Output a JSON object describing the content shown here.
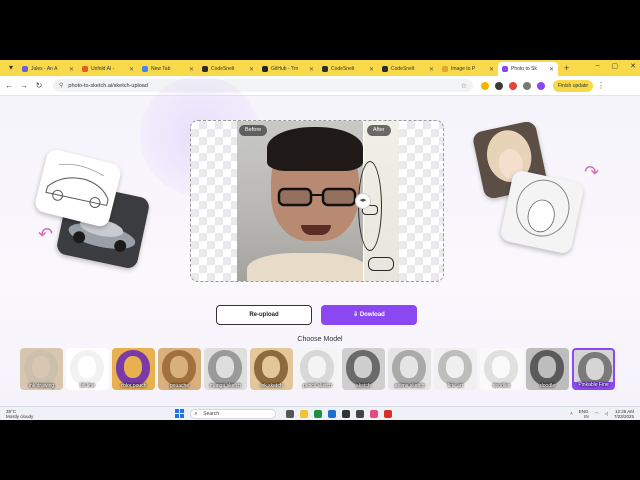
{
  "browser": {
    "tabs": [
      {
        "title": "Jules - An A",
        "color": "#6b5fd6"
      },
      {
        "title": "Unfold AI - ",
        "color": "#e25b2b"
      },
      {
        "title": "New Tab",
        "color": "#4285f4"
      },
      {
        "title": "CodeSnelt",
        "color": "#2b2b2b"
      },
      {
        "title": "GitHub - Trn",
        "color": "#222222"
      },
      {
        "title": "CodeSnelt",
        "color": "#2b2b2b"
      },
      {
        "title": "CodeSnelt",
        "color": "#2b2b2b"
      },
      {
        "title": "Image to P",
        "color": "#e2a52b"
      },
      {
        "title": "Photo to Sk",
        "color": "#8a47f2"
      }
    ],
    "active_tab_index": 8,
    "address": "photo-to-sketch.ai/sketch-upload",
    "finish_update": "Finish update"
  },
  "editor": {
    "before_label": "Before",
    "after_label": "After",
    "reupload_label": "Re-upload",
    "download_label": "Dowload",
    "download_icon": "download-icon",
    "choose_model_label": "Choose Model"
  },
  "models": [
    {
      "label": "ink drawing",
      "tone": "#cbbfae",
      "face": "#d8c6b0"
    },
    {
      "label": "bit line",
      "tone": "#f2f2f2",
      "face": "#ffffff"
    },
    {
      "label": "color pouch",
      "tone": "#7a3aa8",
      "face": "#e8b04f"
    },
    {
      "label": "gouache",
      "tone": "#a0713d",
      "face": "#d7b07d"
    },
    {
      "label": "manga sketch",
      "tone": "#9a9a9a",
      "face": "#dedede"
    },
    {
      "label": "ink sketch",
      "tone": "#8f6a3e",
      "face": "#e3c79a"
    },
    {
      "label": "pencil sketch",
      "tone": "#d8d8d8",
      "face": "#f4f4f4"
    },
    {
      "label": "sketch",
      "tone": "#6a6a6a",
      "face": "#cfcfcf"
    },
    {
      "label": "anime sketch",
      "tone": "#aaaaaa",
      "face": "#e5e5e5"
    },
    {
      "label": "line art",
      "tone": "#bdbdbd",
      "face": "#f0f0f0"
    },
    {
      "label": "doodles",
      "tone": "#e0e0e0",
      "face": "#fafafa"
    },
    {
      "label": "doodle",
      "tone": "#5a5a5a",
      "face": "#bdbdbd"
    },
    {
      "label": "Pinkable Fine",
      "tone": "#7a7a7a",
      "face": "#d5d5d5"
    }
  ],
  "selected_model_index": 12,
  "taskbar": {
    "weather_temp": "38°C",
    "weather_text": "Mostly cloudy",
    "search_placeholder": "Search",
    "lang_line1": "ENG",
    "lang_line2": "IN",
    "time": "12:26 AM",
    "date": "7/23/2025"
  },
  "accent_color": "#8a47f2"
}
